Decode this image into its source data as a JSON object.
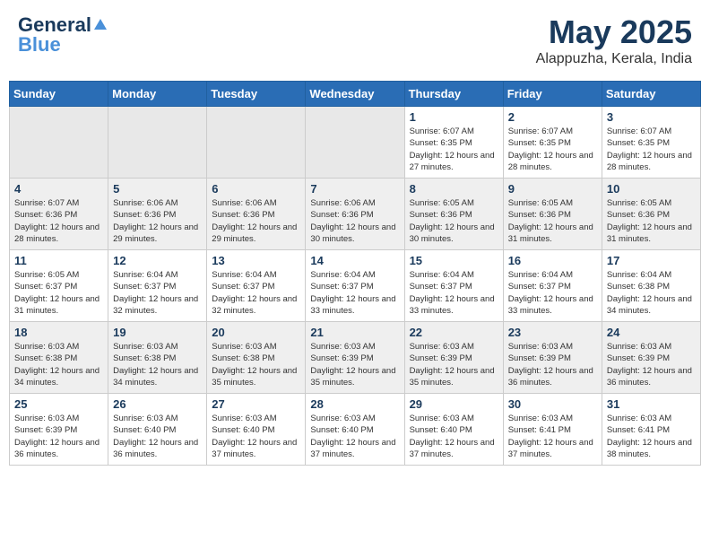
{
  "header": {
    "logo_general": "General",
    "logo_blue": "Blue",
    "month_year": "May 2025",
    "location": "Alappuzha, Kerala, India"
  },
  "days_of_week": [
    "Sunday",
    "Monday",
    "Tuesday",
    "Wednesday",
    "Thursday",
    "Friday",
    "Saturday"
  ],
  "weeks": [
    [
      {
        "day": "",
        "empty": true
      },
      {
        "day": "",
        "empty": true
      },
      {
        "day": "",
        "empty": true
      },
      {
        "day": "",
        "empty": true
      },
      {
        "day": "1",
        "sunrise": "6:07 AM",
        "sunset": "6:35 PM",
        "daylight": "12 hours and 27 minutes."
      },
      {
        "day": "2",
        "sunrise": "6:07 AM",
        "sunset": "6:35 PM",
        "daylight": "12 hours and 28 minutes."
      },
      {
        "day": "3",
        "sunrise": "6:07 AM",
        "sunset": "6:35 PM",
        "daylight": "12 hours and 28 minutes."
      }
    ],
    [
      {
        "day": "4",
        "sunrise": "6:07 AM",
        "sunset": "6:36 PM",
        "daylight": "12 hours and 28 minutes."
      },
      {
        "day": "5",
        "sunrise": "6:06 AM",
        "sunset": "6:36 PM",
        "daylight": "12 hours and 29 minutes."
      },
      {
        "day": "6",
        "sunrise": "6:06 AM",
        "sunset": "6:36 PM",
        "daylight": "12 hours and 29 minutes."
      },
      {
        "day": "7",
        "sunrise": "6:06 AM",
        "sunset": "6:36 PM",
        "daylight": "12 hours and 30 minutes."
      },
      {
        "day": "8",
        "sunrise": "6:05 AM",
        "sunset": "6:36 PM",
        "daylight": "12 hours and 30 minutes."
      },
      {
        "day": "9",
        "sunrise": "6:05 AM",
        "sunset": "6:36 PM",
        "daylight": "12 hours and 31 minutes."
      },
      {
        "day": "10",
        "sunrise": "6:05 AM",
        "sunset": "6:36 PM",
        "daylight": "12 hours and 31 minutes."
      }
    ],
    [
      {
        "day": "11",
        "sunrise": "6:05 AM",
        "sunset": "6:37 PM",
        "daylight": "12 hours and 31 minutes."
      },
      {
        "day": "12",
        "sunrise": "6:04 AM",
        "sunset": "6:37 PM",
        "daylight": "12 hours and 32 minutes."
      },
      {
        "day": "13",
        "sunrise": "6:04 AM",
        "sunset": "6:37 PM",
        "daylight": "12 hours and 32 minutes."
      },
      {
        "day": "14",
        "sunrise": "6:04 AM",
        "sunset": "6:37 PM",
        "daylight": "12 hours and 33 minutes."
      },
      {
        "day": "15",
        "sunrise": "6:04 AM",
        "sunset": "6:37 PM",
        "daylight": "12 hours and 33 minutes."
      },
      {
        "day": "16",
        "sunrise": "6:04 AM",
        "sunset": "6:37 PM",
        "daylight": "12 hours and 33 minutes."
      },
      {
        "day": "17",
        "sunrise": "6:04 AM",
        "sunset": "6:38 PM",
        "daylight": "12 hours and 34 minutes."
      }
    ],
    [
      {
        "day": "18",
        "sunrise": "6:03 AM",
        "sunset": "6:38 PM",
        "daylight": "12 hours and 34 minutes."
      },
      {
        "day": "19",
        "sunrise": "6:03 AM",
        "sunset": "6:38 PM",
        "daylight": "12 hours and 34 minutes."
      },
      {
        "day": "20",
        "sunrise": "6:03 AM",
        "sunset": "6:38 PM",
        "daylight": "12 hours and 35 minutes."
      },
      {
        "day": "21",
        "sunrise": "6:03 AM",
        "sunset": "6:39 PM",
        "daylight": "12 hours and 35 minutes."
      },
      {
        "day": "22",
        "sunrise": "6:03 AM",
        "sunset": "6:39 PM",
        "daylight": "12 hours and 35 minutes."
      },
      {
        "day": "23",
        "sunrise": "6:03 AM",
        "sunset": "6:39 PM",
        "daylight": "12 hours and 36 minutes."
      },
      {
        "day": "24",
        "sunrise": "6:03 AM",
        "sunset": "6:39 PM",
        "daylight": "12 hours and 36 minutes."
      }
    ],
    [
      {
        "day": "25",
        "sunrise": "6:03 AM",
        "sunset": "6:39 PM",
        "daylight": "12 hours and 36 minutes."
      },
      {
        "day": "26",
        "sunrise": "6:03 AM",
        "sunset": "6:40 PM",
        "daylight": "12 hours and 36 minutes."
      },
      {
        "day": "27",
        "sunrise": "6:03 AM",
        "sunset": "6:40 PM",
        "daylight": "12 hours and 37 minutes."
      },
      {
        "day": "28",
        "sunrise": "6:03 AM",
        "sunset": "6:40 PM",
        "daylight": "12 hours and 37 minutes."
      },
      {
        "day": "29",
        "sunrise": "6:03 AM",
        "sunset": "6:40 PM",
        "daylight": "12 hours and 37 minutes."
      },
      {
        "day": "30",
        "sunrise": "6:03 AM",
        "sunset": "6:41 PM",
        "daylight": "12 hours and 37 minutes."
      },
      {
        "day": "31",
        "sunrise": "6:03 AM",
        "sunset": "6:41 PM",
        "daylight": "12 hours and 38 minutes."
      }
    ]
  ],
  "labels": {
    "sunrise": "Sunrise:",
    "sunset": "Sunset:",
    "daylight": "Daylight:"
  }
}
